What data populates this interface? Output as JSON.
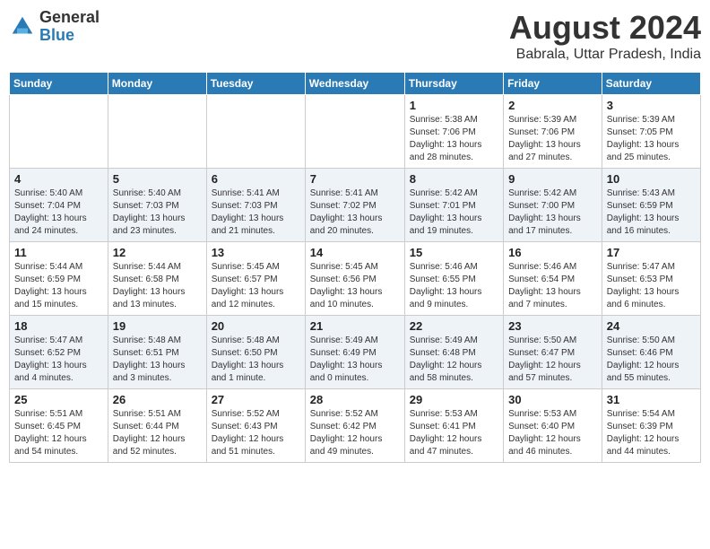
{
  "header": {
    "logo": {
      "general": "General",
      "blue": "Blue"
    },
    "title": "August 2024",
    "location": "Babrala, Uttar Pradesh, India"
  },
  "days_of_week": [
    "Sunday",
    "Monday",
    "Tuesday",
    "Wednesday",
    "Thursday",
    "Friday",
    "Saturday"
  ],
  "weeks": [
    [
      {
        "day": "",
        "info": ""
      },
      {
        "day": "",
        "info": ""
      },
      {
        "day": "",
        "info": ""
      },
      {
        "day": "",
        "info": ""
      },
      {
        "day": "1",
        "info": "Sunrise: 5:38 AM\nSunset: 7:06 PM\nDaylight: 13 hours\nand 28 minutes."
      },
      {
        "day": "2",
        "info": "Sunrise: 5:39 AM\nSunset: 7:06 PM\nDaylight: 13 hours\nand 27 minutes."
      },
      {
        "day": "3",
        "info": "Sunrise: 5:39 AM\nSunset: 7:05 PM\nDaylight: 13 hours\nand 25 minutes."
      }
    ],
    [
      {
        "day": "4",
        "info": "Sunrise: 5:40 AM\nSunset: 7:04 PM\nDaylight: 13 hours\nand 24 minutes."
      },
      {
        "day": "5",
        "info": "Sunrise: 5:40 AM\nSunset: 7:03 PM\nDaylight: 13 hours\nand 23 minutes."
      },
      {
        "day": "6",
        "info": "Sunrise: 5:41 AM\nSunset: 7:03 PM\nDaylight: 13 hours\nand 21 minutes."
      },
      {
        "day": "7",
        "info": "Sunrise: 5:41 AM\nSunset: 7:02 PM\nDaylight: 13 hours\nand 20 minutes."
      },
      {
        "day": "8",
        "info": "Sunrise: 5:42 AM\nSunset: 7:01 PM\nDaylight: 13 hours\nand 19 minutes."
      },
      {
        "day": "9",
        "info": "Sunrise: 5:42 AM\nSunset: 7:00 PM\nDaylight: 13 hours\nand 17 minutes."
      },
      {
        "day": "10",
        "info": "Sunrise: 5:43 AM\nSunset: 6:59 PM\nDaylight: 13 hours\nand 16 minutes."
      }
    ],
    [
      {
        "day": "11",
        "info": "Sunrise: 5:44 AM\nSunset: 6:59 PM\nDaylight: 13 hours\nand 15 minutes."
      },
      {
        "day": "12",
        "info": "Sunrise: 5:44 AM\nSunset: 6:58 PM\nDaylight: 13 hours\nand 13 minutes."
      },
      {
        "day": "13",
        "info": "Sunrise: 5:45 AM\nSunset: 6:57 PM\nDaylight: 13 hours\nand 12 minutes."
      },
      {
        "day": "14",
        "info": "Sunrise: 5:45 AM\nSunset: 6:56 PM\nDaylight: 13 hours\nand 10 minutes."
      },
      {
        "day": "15",
        "info": "Sunrise: 5:46 AM\nSunset: 6:55 PM\nDaylight: 13 hours\nand 9 minutes."
      },
      {
        "day": "16",
        "info": "Sunrise: 5:46 AM\nSunset: 6:54 PM\nDaylight: 13 hours\nand 7 minutes."
      },
      {
        "day": "17",
        "info": "Sunrise: 5:47 AM\nSunset: 6:53 PM\nDaylight: 13 hours\nand 6 minutes."
      }
    ],
    [
      {
        "day": "18",
        "info": "Sunrise: 5:47 AM\nSunset: 6:52 PM\nDaylight: 13 hours\nand 4 minutes."
      },
      {
        "day": "19",
        "info": "Sunrise: 5:48 AM\nSunset: 6:51 PM\nDaylight: 13 hours\nand 3 minutes."
      },
      {
        "day": "20",
        "info": "Sunrise: 5:48 AM\nSunset: 6:50 PM\nDaylight: 13 hours\nand 1 minute."
      },
      {
        "day": "21",
        "info": "Sunrise: 5:49 AM\nSunset: 6:49 PM\nDaylight: 13 hours\nand 0 minutes."
      },
      {
        "day": "22",
        "info": "Sunrise: 5:49 AM\nSunset: 6:48 PM\nDaylight: 12 hours\nand 58 minutes."
      },
      {
        "day": "23",
        "info": "Sunrise: 5:50 AM\nSunset: 6:47 PM\nDaylight: 12 hours\nand 57 minutes."
      },
      {
        "day": "24",
        "info": "Sunrise: 5:50 AM\nSunset: 6:46 PM\nDaylight: 12 hours\nand 55 minutes."
      }
    ],
    [
      {
        "day": "25",
        "info": "Sunrise: 5:51 AM\nSunset: 6:45 PM\nDaylight: 12 hours\nand 54 minutes."
      },
      {
        "day": "26",
        "info": "Sunrise: 5:51 AM\nSunset: 6:44 PM\nDaylight: 12 hours\nand 52 minutes."
      },
      {
        "day": "27",
        "info": "Sunrise: 5:52 AM\nSunset: 6:43 PM\nDaylight: 12 hours\nand 51 minutes."
      },
      {
        "day": "28",
        "info": "Sunrise: 5:52 AM\nSunset: 6:42 PM\nDaylight: 12 hours\nand 49 minutes."
      },
      {
        "day": "29",
        "info": "Sunrise: 5:53 AM\nSunset: 6:41 PM\nDaylight: 12 hours\nand 47 minutes."
      },
      {
        "day": "30",
        "info": "Sunrise: 5:53 AM\nSunset: 6:40 PM\nDaylight: 12 hours\nand 46 minutes."
      },
      {
        "day": "31",
        "info": "Sunrise: 5:54 AM\nSunset: 6:39 PM\nDaylight: 12 hours\nand 44 minutes."
      }
    ]
  ]
}
